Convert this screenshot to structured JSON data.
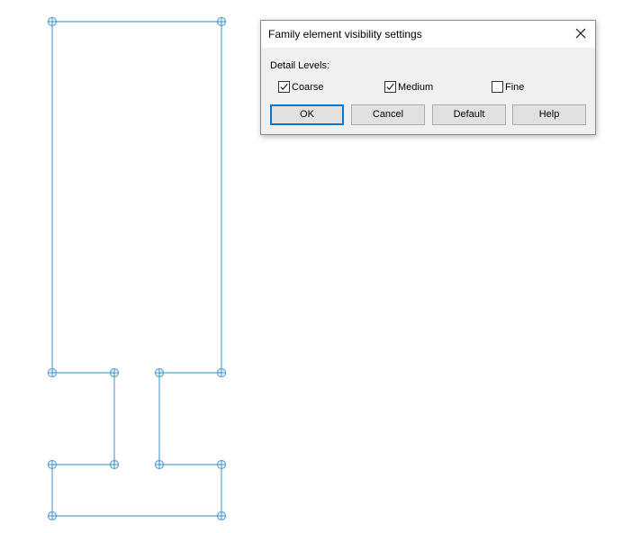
{
  "dialog": {
    "title": "Family element visibility settings",
    "group_label": "Detail Levels:",
    "close_icon": "close-icon",
    "checkboxes": [
      {
        "label": "Coarse",
        "checked": true
      },
      {
        "label": "Medium",
        "checked": true
      },
      {
        "label": "Fine",
        "checked": false
      }
    ],
    "buttons": {
      "ok": "OK",
      "cancel": "Cancel",
      "default": "Default",
      "help": "Help"
    }
  },
  "colors": {
    "sketch_line": "#5ba3d0",
    "focus_border": "#0078d7",
    "dialog_bg": "#f0f0f0"
  }
}
